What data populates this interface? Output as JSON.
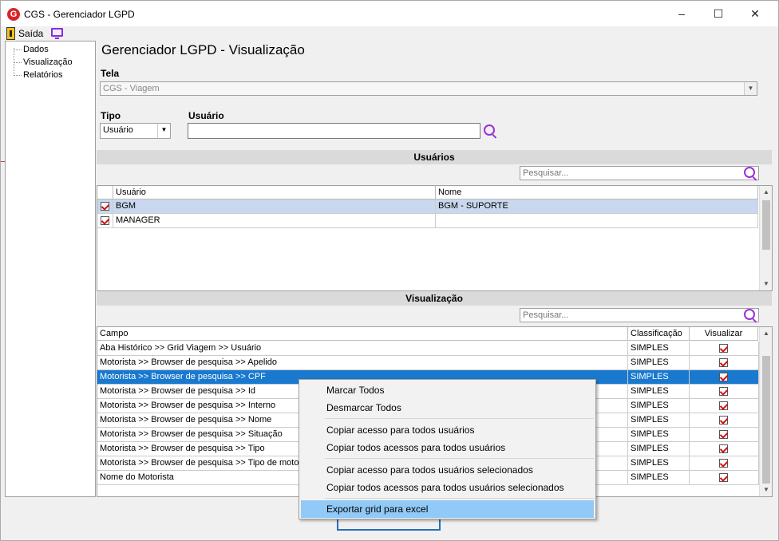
{
  "window": {
    "title": "CGS - Gerenciador LGPD",
    "logo_letter": "G",
    "minimize": "–",
    "maximize": "☐",
    "close": "✕"
  },
  "menubar": {
    "exit_label": "Saída"
  },
  "tree": {
    "items": [
      "Dados",
      "Visualização",
      "Relatórios"
    ]
  },
  "main": {
    "title": "Gerenciador LGPD - Visualização",
    "tela_label": "Tela",
    "tela_value": "CGS - Viagem",
    "tipo_label": "Tipo",
    "tipo_value": "Usuário",
    "usuario_label": "Usuário",
    "usuario_value": ""
  },
  "usuarios": {
    "header": "Usuários",
    "search_placeholder": "Pesquisar...",
    "columns": [
      "Usuário",
      "Nome"
    ],
    "rows": [
      {
        "usuario": "BGM",
        "nome": "BGM - SUPORTE",
        "checked": true
      },
      {
        "usuario": "MANAGER",
        "nome": "",
        "checked": true
      }
    ]
  },
  "visualizacao": {
    "header": "Visualização",
    "search_placeholder": "Pesquisar...",
    "columns": [
      "Campo",
      "Classificação",
      "Visualizar"
    ],
    "rows": [
      {
        "campo": "Aba Histórico >> Grid Viagem >> Usuário",
        "classificacao": "SIMPLES",
        "visualizar": true
      },
      {
        "campo": "Motorista >> Browser de pesquisa >> Apelido",
        "classificacao": "SIMPLES",
        "visualizar": true
      },
      {
        "campo": "Motorista >> Browser de pesquisa >> CPF",
        "classificacao": "SIMPLES",
        "visualizar": true
      },
      {
        "campo": "Motorista >> Browser de pesquisa >> Id",
        "classificacao": "SIMPLES",
        "visualizar": true
      },
      {
        "campo": "Motorista >> Browser de pesquisa >> Interno",
        "classificacao": "SIMPLES",
        "visualizar": true
      },
      {
        "campo": "Motorista >> Browser de pesquisa >> Nome",
        "classificacao": "SIMPLES",
        "visualizar": true
      },
      {
        "campo": "Motorista >> Browser de pesquisa >> Situação",
        "classificacao": "SIMPLES",
        "visualizar": true
      },
      {
        "campo": "Motorista >> Browser de pesquisa >> Tipo",
        "classificacao": "SIMPLES",
        "visualizar": true
      },
      {
        "campo": "Motorista >> Browser de pesquisa >> Tipo de motoris",
        "classificacao": "SIMPLES",
        "visualizar": true
      },
      {
        "campo": "Nome do Motorista",
        "classificacao": "SIMPLES",
        "visualizar": true
      }
    ]
  },
  "context_menu": {
    "items": [
      "Marcar Todos",
      "Desmarcar Todos",
      "Copiar acesso para todos usuários",
      "Copiar todos acessos para todos usuários",
      "Copiar acesso para todos usuários selecionados",
      "Copiar todos acessos para todos usuários selecionados",
      "Exportar grid para excel"
    ]
  },
  "colors": {
    "selection": "#1979ce",
    "row_highlight": "#c9d8ee",
    "menu_hover": "#91c9f7",
    "accent_icon": "#9b30d9",
    "check": "#d01010"
  }
}
